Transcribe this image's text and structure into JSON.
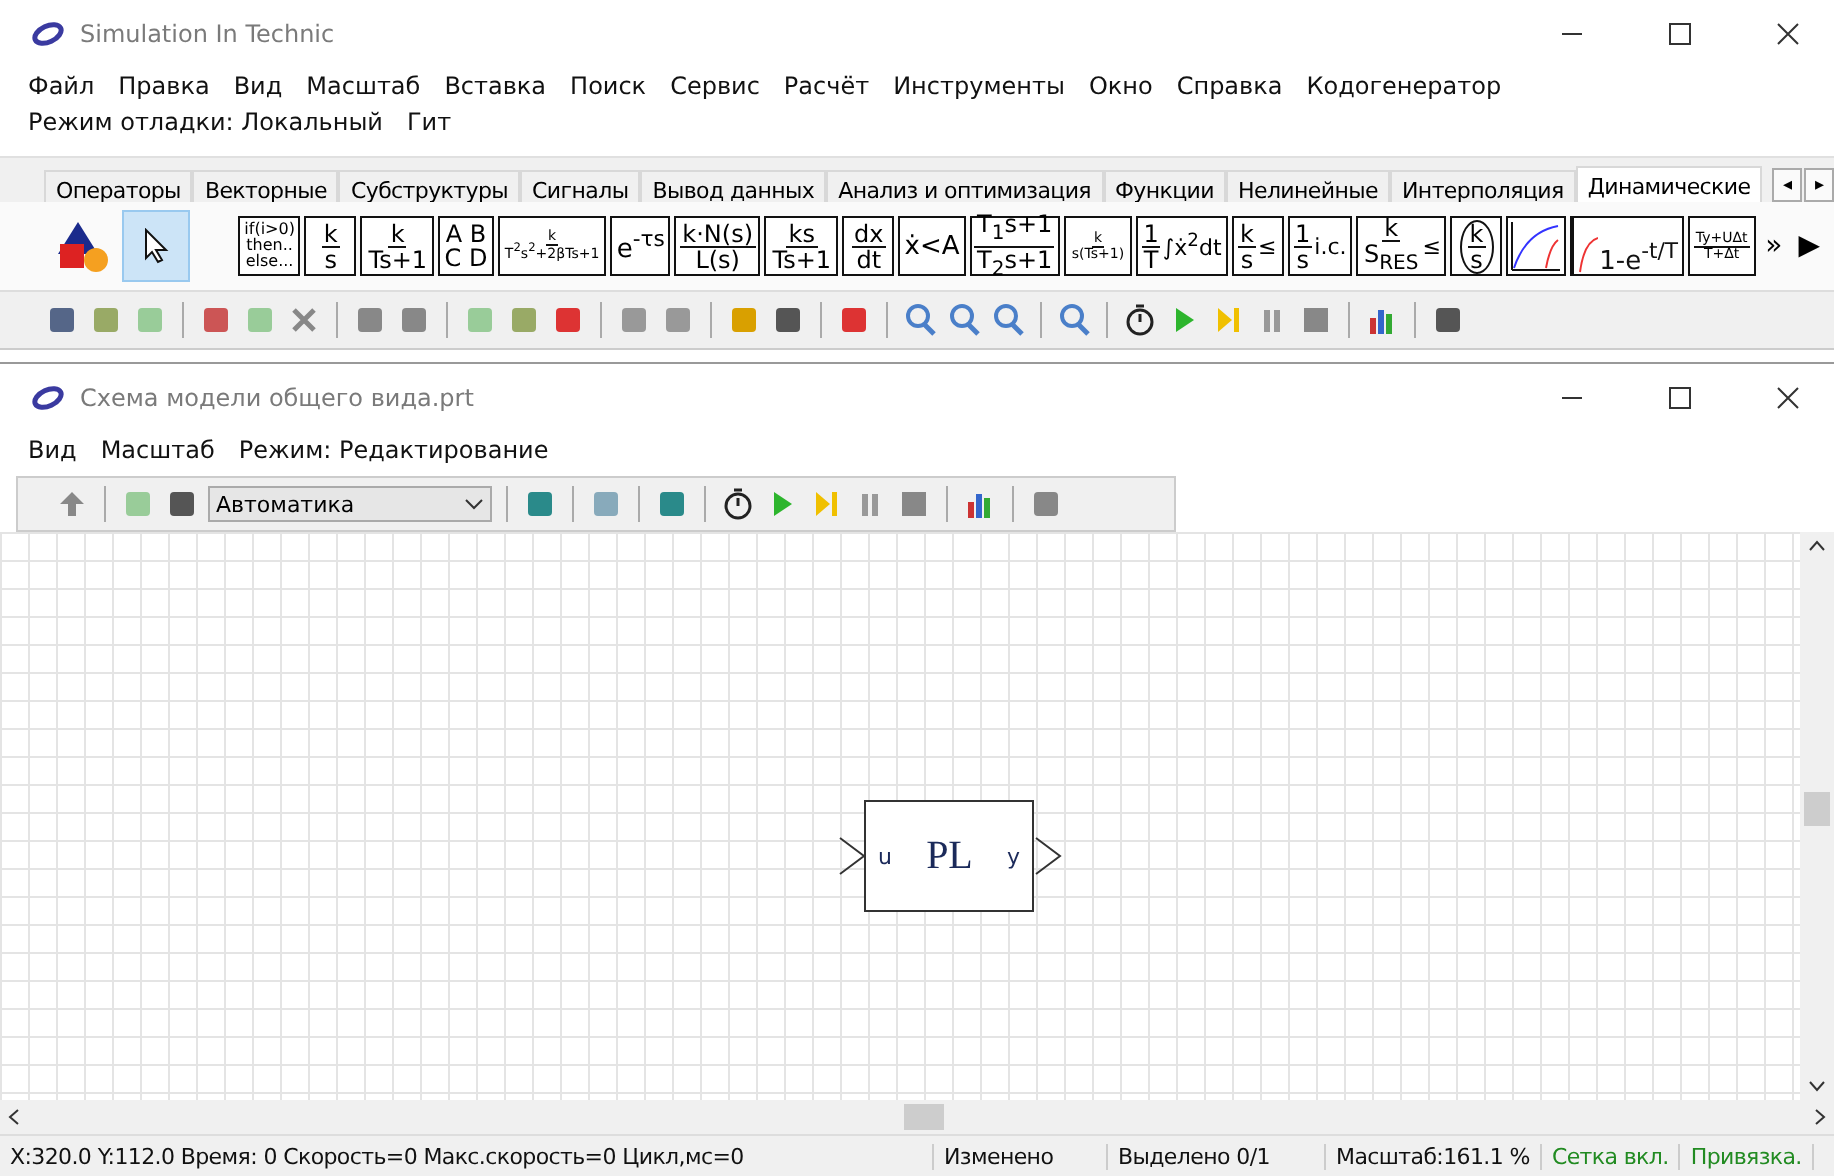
{
  "app_window": {
    "title": "Simulation In Technic"
  },
  "menu": [
    "Файл",
    "Правка",
    "Вид",
    "Масштаб",
    "Вставка",
    "Поиск",
    "Сервис",
    "Расчёт",
    "Инструменты",
    "Окно",
    "Справка",
    "Кодогенератор"
  ],
  "menu2": [
    "Режим отладки: Локальный",
    "Гит"
  ],
  "palette_tabs": [
    {
      "label": "Операторы",
      "selected": false
    },
    {
      "label": "Векторные",
      "selected": false
    },
    {
      "label": "Субструктуры",
      "selected": false
    },
    {
      "label": "Сигналы",
      "selected": false
    },
    {
      "label": "Вывод данных",
      "selected": false
    },
    {
      "label": "Анализ и оптимизация",
      "selected": false
    },
    {
      "label": "Функции",
      "selected": false
    },
    {
      "label": "Нелинейные",
      "selected": false
    },
    {
      "label": "Интерполяция",
      "selected": false
    },
    {
      "label": "Динамические",
      "selected": true
    }
  ],
  "tab_scroll": [
    "◂",
    "▸"
  ],
  "palette_tools": [
    {
      "kind": "shapes",
      "selected": false
    },
    {
      "kind": "pointer",
      "selected": true
    }
  ],
  "palette_blocks": [
    {
      "kind": "lines",
      "lines": [
        "if(i>0)",
        "then..",
        "else..."
      ]
    },
    {
      "kind": "fraction",
      "num": "k",
      "den": "s"
    },
    {
      "kind": "fraction",
      "num": "k",
      "den": "Ts+1"
    },
    {
      "kind": "lines",
      "lines": [
        "A B",
        "C D"
      ]
    },
    {
      "kind": "fraction",
      "num": "k",
      "den": "T$^{2}$s$^{2}$+2βTs+1",
      "small": true
    },
    {
      "kind": "lines",
      "lines": [
        "e$^{-τs}$"
      ]
    },
    {
      "kind": "fraction",
      "num": "k·N(s)",
      "den": "L(s)"
    },
    {
      "kind": "fraction",
      "num": "ks",
      "den": "Ts+1"
    },
    {
      "kind": "fraction",
      "num": "dx",
      "den": "dt"
    },
    {
      "kind": "lines",
      "lines": [
        "ẋ<A"
      ]
    },
    {
      "kind": "fraction",
      "num": "T$_{1}$s+1",
      "den": "T$_{2}$s+1"
    },
    {
      "kind": "fraction",
      "num": "k",
      "den": "s(Ts+1)",
      "small": true
    },
    {
      "kind": "fraction",
      "num": "1",
      "den": "T",
      "suffix": "∫ẋ$^{2}$dt"
    },
    {
      "kind": "fraction",
      "num": "k",
      "den": "s",
      "suffix": "≤"
    },
    {
      "kind": "fraction",
      "num": "1",
      "den": "s",
      "suffix": "i.c."
    },
    {
      "kind": "fraction",
      "num": "k",
      "den": "S$_{RES}$",
      "suffix": "≤"
    },
    {
      "kind": "circle",
      "num": "k",
      "den": "s"
    },
    {
      "kind": "graph"
    },
    {
      "kind": "lines",
      "lines": [
        "1-e$^{-t/T}$"
      ],
      "graph": true
    },
    {
      "kind": "fraction",
      "num": "Ty+UΔt",
      "den": "T+Δt",
      "small": true
    }
  ],
  "palette_more": [
    "»",
    "▶"
  ],
  "child_window": {
    "title": "Схема модели общего вида.prt"
  },
  "child_menu": [
    "Вид",
    "Масштаб",
    "Режим: Редактирование"
  ],
  "mode_select": {
    "value": "Автоматика"
  },
  "diagram": {
    "block": {
      "label": "PL",
      "input": "u",
      "output": "y"
    }
  },
  "status_bar": {
    "coords": "X:320.0  Y:112.0 Время: 0 Скорость=0 Макс.скорость=0 Цикл,мс=0",
    "modified": "Изменено",
    "selection": "Выделено 0/1",
    "zoom": "Масштаб:161.1 %",
    "toggles": [
      {
        "label": "Сетка вкл.",
        "on": true
      },
      {
        "label": "Привязка.",
        "on": true
      }
    ]
  }
}
